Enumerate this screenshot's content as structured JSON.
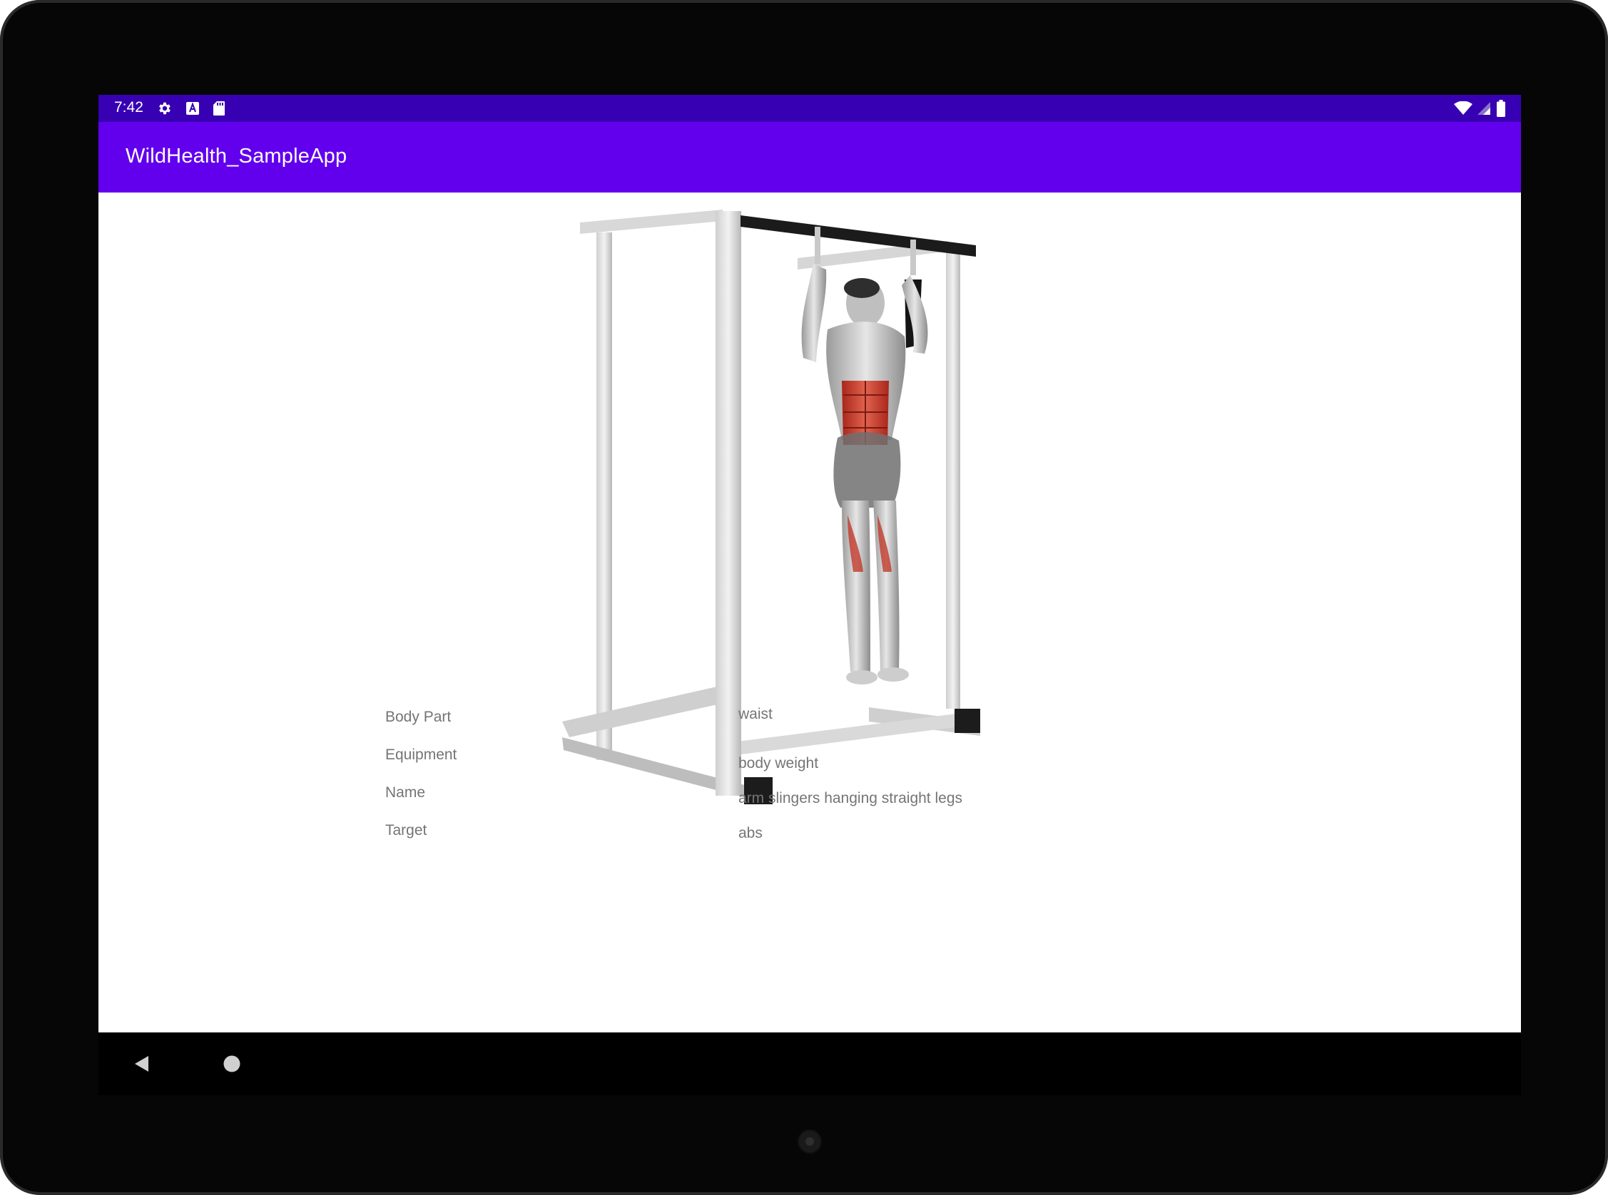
{
  "status_bar": {
    "time": "7:42",
    "left_icons": [
      "settings-icon",
      "font-a-icon",
      "sd-card-icon"
    ],
    "right_icons": [
      "wifi-icon",
      "signal-icon",
      "battery-icon"
    ],
    "background": "#3700b3"
  },
  "app_bar": {
    "title": "WildHealth_SampleApp",
    "background": "#6200ee"
  },
  "exercise": {
    "image_icon": "exercise-illustration",
    "details": [
      {
        "label": "Body Part",
        "value": "waist"
      },
      {
        "label": "Equipment",
        "value": "body weight"
      },
      {
        "label": "Name",
        "value": "arm slingers hanging straight legs"
      },
      {
        "label": "Target",
        "value": "abs"
      }
    ]
  },
  "nav_bar": {
    "buttons": [
      "back-icon",
      "home-icon"
    ]
  },
  "colors": {
    "text_secondary": "#757575",
    "highlight_muscle": "#c0392b"
  }
}
